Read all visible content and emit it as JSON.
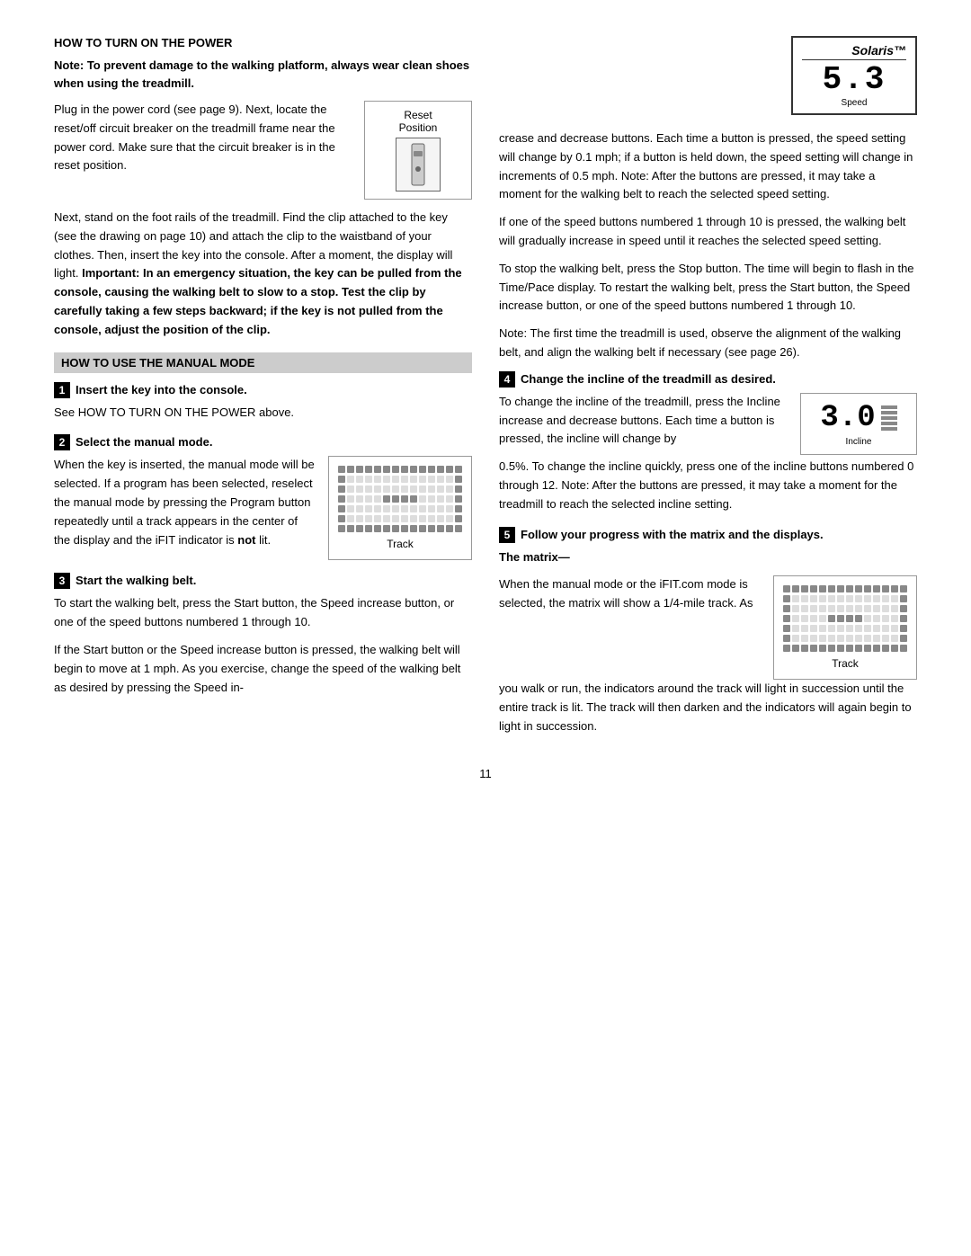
{
  "page": {
    "number": "11"
  },
  "left": {
    "section1_title": "HOW TO TURN ON THE POWER",
    "bold_note": "Note: To prevent damage to the walking platform, always wear clean shoes when using the treadmill.",
    "para1": "Plug in the power cord (see page 9). Next, locate the reset/off circuit breaker on the treadmill frame near the power cord. Make sure that the circuit breaker is in the reset position.",
    "reset_label1": "Reset",
    "reset_label2": "Position",
    "para2": "Next, stand on the foot rails of the treadmill. Find the clip attached to the key (see the drawing on page 10) and attach the clip to the waistband of your clothes. Then, insert the key into the console. After a moment, the display will light.",
    "para2b": "Important: In an emergency situation, the key can be pulled from the console, causing the walking belt to slow to a stop. Test the clip by carefully taking a few steps backward; if the key is not pulled from the console, adjust the position of the clip.",
    "section2_title": "HOW TO USE THE MANUAL MODE",
    "step1_num": "1",
    "step1_header": "Insert the key into the console.",
    "step1_text": "See HOW TO TURN ON THE POWER above.",
    "step2_num": "2",
    "step2_header": "Select the manual mode.",
    "step2_text1": "When the key is inserted, the manual mode will be selected. If a program has been selected, reselect the manual mode by pressing the Program button repeatedly until a track appears in the center of the display and the iFIT indicator is ",
    "step2_not": "not",
    "step2_text2": " lit.",
    "track_label": "Track",
    "step3_num": "3",
    "step3_header": "Start the walking belt.",
    "step3_text1": "To start the walking belt, press the Start button, the Speed increase button, or one of the speed buttons numbered 1 through 10.",
    "step3_text2": "If the Start button or the Speed increase button is pressed, the walking belt will begin to move at 1 mph. As you exercise, change the speed of the walking belt as desired by pressing the Speed in-"
  },
  "right": {
    "solaris_title": "Solaris™",
    "solaris_number": "5.3",
    "solaris_sublabel": "Speed",
    "para_right1": "crease and decrease buttons. Each time a button is pressed, the speed setting will change by 0.1 mph; if a button is held down, the speed setting will change in increments of 0.5 mph. Note: After the buttons are pressed, it may take a moment for the walking belt to reach the selected speed setting.",
    "para_right2": "If one of the speed buttons numbered 1 through 10 is pressed, the walking belt will gradually increase in speed until it reaches the selected speed setting.",
    "para_right3": "To stop the walking belt, press the Stop button. The time will begin to flash in the Time/Pace display. To restart the walking belt, press the Start button, the Speed increase button, or one of the speed buttons numbered 1 through 10.",
    "para_right4": "Note: The first time the treadmill is used, observe the alignment of the walking belt, and align the walking belt if necessary (see page 26).",
    "step4_num": "4",
    "step4_header": "Change the incline of the treadmill as desired.",
    "step4_text1": "To change the incline of the treadmill, press the Incline increase and decrease buttons. Each time a button is pressed, the incline will change by",
    "incline_number": "3.0",
    "incline_sublabel": "Incline",
    "step4_text2": "0.5%. To change the incline quickly, press one of the incline buttons numbered 0 through 12. Note: After the buttons are pressed, it may take a moment for the treadmill to reach the selected incline setting.",
    "step5_num": "5",
    "step5_header": "Follow your progress with the matrix and the displays.",
    "matrix_title": "The matrix—",
    "matrix_text1": "When the manual mode or the iFIT.com mode is selected, the matrix will show a 1/4-mile track. As",
    "track_label2": "Track",
    "matrix_text2": "you walk or run, the indicators around the track will light in succession until the entire track is lit. The track will then darken and the indicators will again begin to light in succession."
  }
}
